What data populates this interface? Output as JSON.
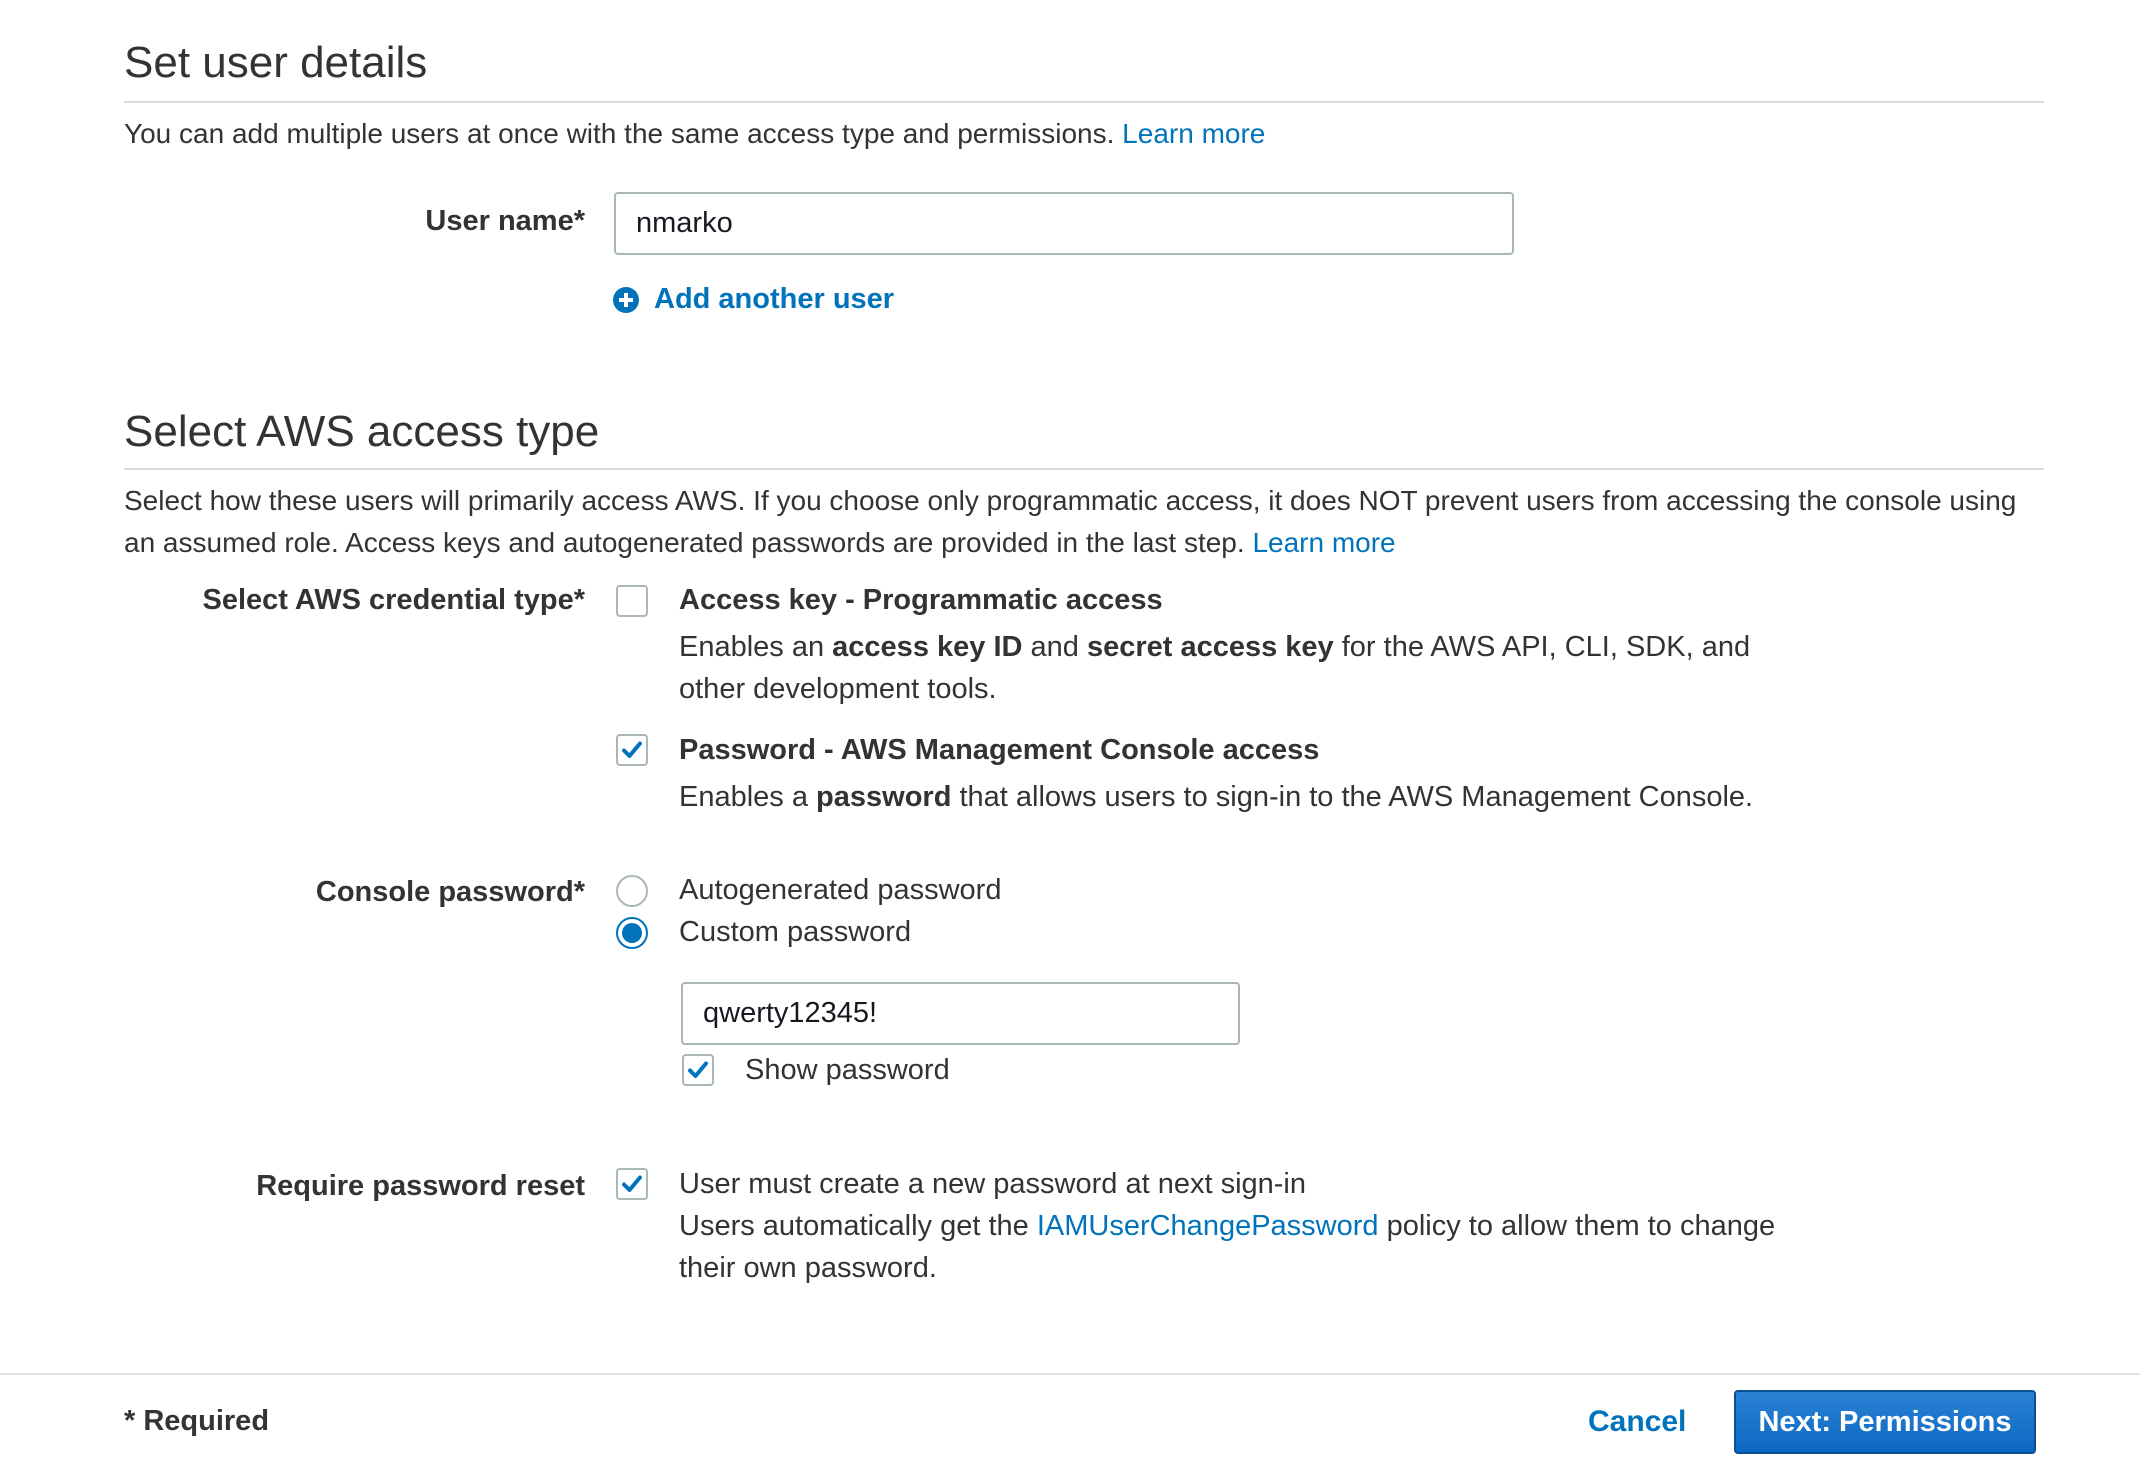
{
  "user_details": {
    "heading": "Set user details",
    "description": "You can add multiple users at once with the same access type and permissions.",
    "learn_more": "Learn more",
    "user_name_label": "User name*",
    "user_name_value": "nmarko",
    "add_user_label": "Add another user"
  },
  "access_type": {
    "heading": "Select AWS access type",
    "description_line1": "Select how these users will primarily access AWS. If you choose only programmatic access, it does NOT prevent users from accessing the console using",
    "description_line2": "an assumed role. Access keys and autogenerated passwords are provided in the last step.",
    "learn_more": "Learn more",
    "credential_label": "Select AWS credential type*",
    "options": [
      {
        "title": "Access key - Programmatic access",
        "checked": false,
        "text_1": "Enables an ",
        "bold_1": "access key ID",
        "text_2": " and ",
        "bold_2": "secret access key",
        "text_3": " for the AWS API, CLI, SDK, and",
        "text_4": "other development tools."
      },
      {
        "title": "Password - AWS Management Console access",
        "checked": true,
        "text_1": "Enables a ",
        "bold_1": "password",
        "text_2": " that allows users to sign-in to the AWS Management Console."
      }
    ]
  },
  "console_password": {
    "label": "Console password*",
    "options": [
      {
        "label": "Autogenerated password",
        "selected": false
      },
      {
        "label": "Custom password",
        "selected": true
      }
    ],
    "value": "qwerty12345!",
    "show_password_label": "Show password",
    "show_password_checked": true
  },
  "password_reset": {
    "label": "Require password reset",
    "checked": true,
    "title": "User must create a new password at next sign-in",
    "text_1": "Users automatically get the ",
    "policy_link": "IAMUserChangePassword",
    "text_2": " policy to allow them to change",
    "text_3": "their own password."
  },
  "footer": {
    "required_note": "* Required",
    "cancel_label": "Cancel",
    "next_label": "Next: Permissions"
  },
  "colors": {
    "link": "#0073bb",
    "primary_button": "#0b68c2",
    "check": "#0073bb"
  },
  "icons": {
    "add": "plus-circle-icon",
    "check": "checkmark-icon"
  }
}
